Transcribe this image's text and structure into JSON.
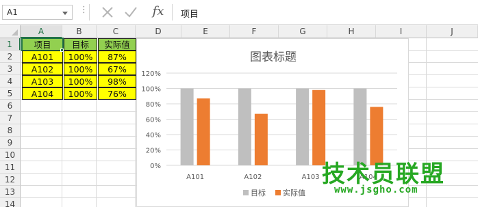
{
  "formula_bar": {
    "name_box": "A1",
    "dots": "⋮",
    "fx": "fx",
    "value": "项目"
  },
  "columns": [
    "A",
    "B",
    "C",
    "D",
    "E",
    "F",
    "G",
    "H",
    "I",
    "J"
  ],
  "rows": [
    "1",
    "2",
    "3",
    "4",
    "5",
    "6",
    "7",
    "8",
    "9",
    "10",
    "11",
    "12",
    "13",
    "14"
  ],
  "table": {
    "headers": [
      "项目",
      "目标",
      "实际值"
    ],
    "rows": [
      [
        "A101",
        "100%",
        "87%"
      ],
      [
        "A102",
        "100%",
        "67%"
      ],
      [
        "A103",
        "100%",
        "98%"
      ],
      [
        "A104",
        "100%",
        "76%"
      ]
    ]
  },
  "colors": {
    "header_fill": "#92d050",
    "data_fill": "#ffff00",
    "target_bar": "#bfbfbf",
    "actual_bar": "#ed7d31",
    "excel_green": "#217346",
    "watermark": "#27a823"
  },
  "chart_data": {
    "type": "bar",
    "title": "图表标题",
    "categories": [
      "A101",
      "A102",
      "A103",
      "A104"
    ],
    "series": [
      {
        "name": "目标",
        "values": [
          100,
          100,
          100,
          100
        ],
        "color": "#bfbfbf"
      },
      {
        "name": "实际值",
        "values": [
          87,
          67,
          98,
          76
        ],
        "color": "#ed7d31"
      }
    ],
    "y_ticks": [
      "0%",
      "20%",
      "40%",
      "60%",
      "80%",
      "100%",
      "120%"
    ],
    "ylim": [
      0,
      120
    ],
    "grid": true,
    "legend": "bottom"
  },
  "watermark": {
    "title": "技术员联盟",
    "url": "www.jsgho.com"
  }
}
